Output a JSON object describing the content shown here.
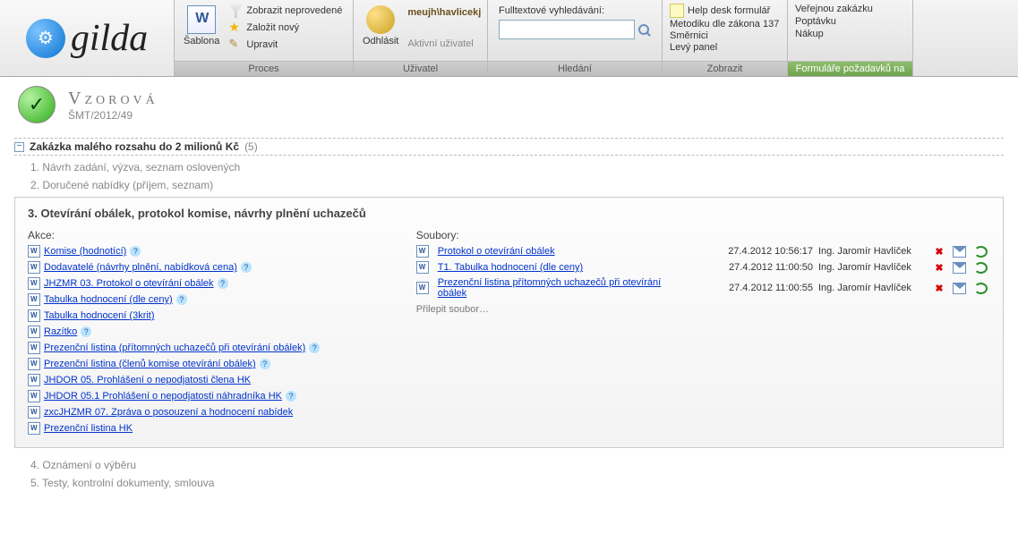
{
  "logo_text": "gilda",
  "ribbon": {
    "proces": {
      "footer": "Proces",
      "template_label": "Šablona",
      "items": [
        "Zobrazit neprovedené",
        "Založit nový",
        "Upravit"
      ]
    },
    "uzivatel": {
      "footer": "Uživatel",
      "logout_label": "Odhlásit",
      "username": "meujh\\havlicekj",
      "sub": "Aktivní uživatel"
    },
    "hledani": {
      "footer": "Hledání",
      "label": "Fulltextové vyhledávání:"
    },
    "zobrazit": {
      "footer": "Zobrazit",
      "items": [
        "Help desk formulář",
        "Metodiku dle zákona 137",
        "Směrnici",
        "Levý panel"
      ]
    },
    "pozadavky": {
      "footer": "Formuláře požadavků na",
      "items": [
        "Veřejnou zakázku",
        "Poptávku",
        "Nákup"
      ]
    }
  },
  "page": {
    "title": "Vzorová",
    "sub": "ŠMT/2012/49"
  },
  "step_group": {
    "title": "Zakázka malého rozsahu do 2 milionů Kč",
    "count": "(5)"
  },
  "steps_header": {
    "s1": "1. Návrh zadání, výzva, seznam oslovených",
    "s2": "2. Doručené nabídky (příjem, seznam)",
    "s4": "4. Oznámení o výběru",
    "s5": "5. Testy, kontrolní dokumenty, smlouva"
  },
  "panel": {
    "title": "3. Otevírání obálek, protokol komise, návrhy plnění uchazečů",
    "actions_label": "Akce:",
    "files_label": "Soubory:",
    "attach_label": "Přilepit soubor…",
    "actions": [
      {
        "text": "Komise (hodnotící)",
        "help": true
      },
      {
        "text": "Dodavatelé (návrhy plnění, nabídková cena)",
        "help": true
      },
      {
        "text": "JHZMR 03. Protokol o otevírání obálek",
        "help": true
      },
      {
        "text": "Tabulka hodnocení (dle ceny)",
        "help": true
      },
      {
        "text": "Tabulka hodnocení (3krit)",
        "help": false
      },
      {
        "text": "Razítko",
        "help": true
      },
      {
        "text": "Prezenční listina (přítomných uchazečů při otevírání obálek)",
        "help": true
      },
      {
        "text": "Prezenční listina (členů komise otevírání obálek)",
        "help": true
      },
      {
        "text": "JHDOR 05. Prohlášení o nepodjatosti člena HK",
        "help": false
      },
      {
        "text": "JHDOR 05.1 Prohlášení o nepodjatosti náhradníka HK",
        "help": true
      },
      {
        "text": "zxcJHZMR 07. Zpráva o posouzení a hodnocení nabídek",
        "help": false
      },
      {
        "text": "Prezenční listina HK",
        "help": false
      }
    ],
    "files": [
      {
        "name": "Protokol o otevírání obálek",
        "time": "27.4.2012 10:56:17",
        "user": "Ing. Jaromír Havlíček"
      },
      {
        "name": "T1. Tabulka hodnocení (dle ceny)",
        "time": "27.4.2012 11:00:50",
        "user": "Ing. Jaromír Havlíček"
      },
      {
        "name": "Prezenční listina přítomných uchazečů při otevírání obálek",
        "time": "27.4.2012 11:00:55",
        "user": "Ing. Jaromír Havlíček"
      }
    ]
  }
}
